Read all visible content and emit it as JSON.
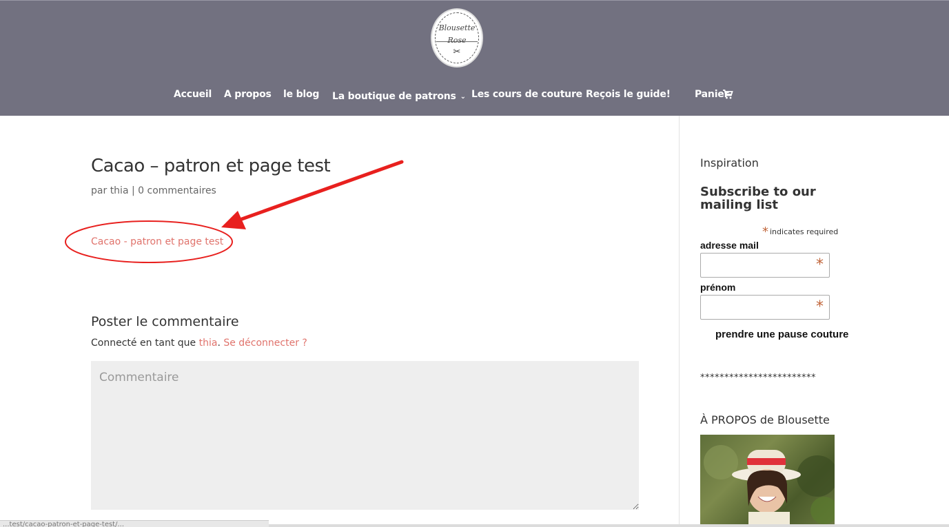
{
  "header": {
    "logo": {
      "line1": "Blousette",
      "line2": "Rose"
    },
    "nav": [
      {
        "label": "Accueil"
      },
      {
        "label": "A propos"
      },
      {
        "label": "le blog"
      },
      {
        "label": "La boutique de patrons"
      },
      {
        "label": "Les cours de couture"
      },
      {
        "label": "Reçois le guide!"
      },
      {
        "label": "Panier"
      }
    ],
    "cart_icon": "cart-icon",
    "bg_color": "#727180"
  },
  "post": {
    "title": "Cacao – patron et page test",
    "by": "par",
    "author": "thia",
    "separator": "|",
    "comments": "0 commentaires",
    "content_link": "Cacao - patron et page test"
  },
  "comments": {
    "heading": "Poster le commentaire",
    "logged_prefix": "Connecté en tant que",
    "user": "thia",
    "logout": "Se déconnecter ?",
    "placeholder": "Commentaire"
  },
  "sidebar": {
    "inspiration": "Inspiration",
    "subscribe_title": "Subscribe to our mailing list",
    "required_mark": "*",
    "required_note": "indicates required",
    "email_label": "adresse mail",
    "firstname_label": "prénom",
    "submit_label": "prendre une pause couture",
    "stars": "************************",
    "about_title": "À PROPOS de Blousette"
  },
  "status": {
    "url": "...test/cacao-patron-et-page-test/..."
  },
  "colors": {
    "link": "#e0736c",
    "annotation": "#e8201e"
  }
}
